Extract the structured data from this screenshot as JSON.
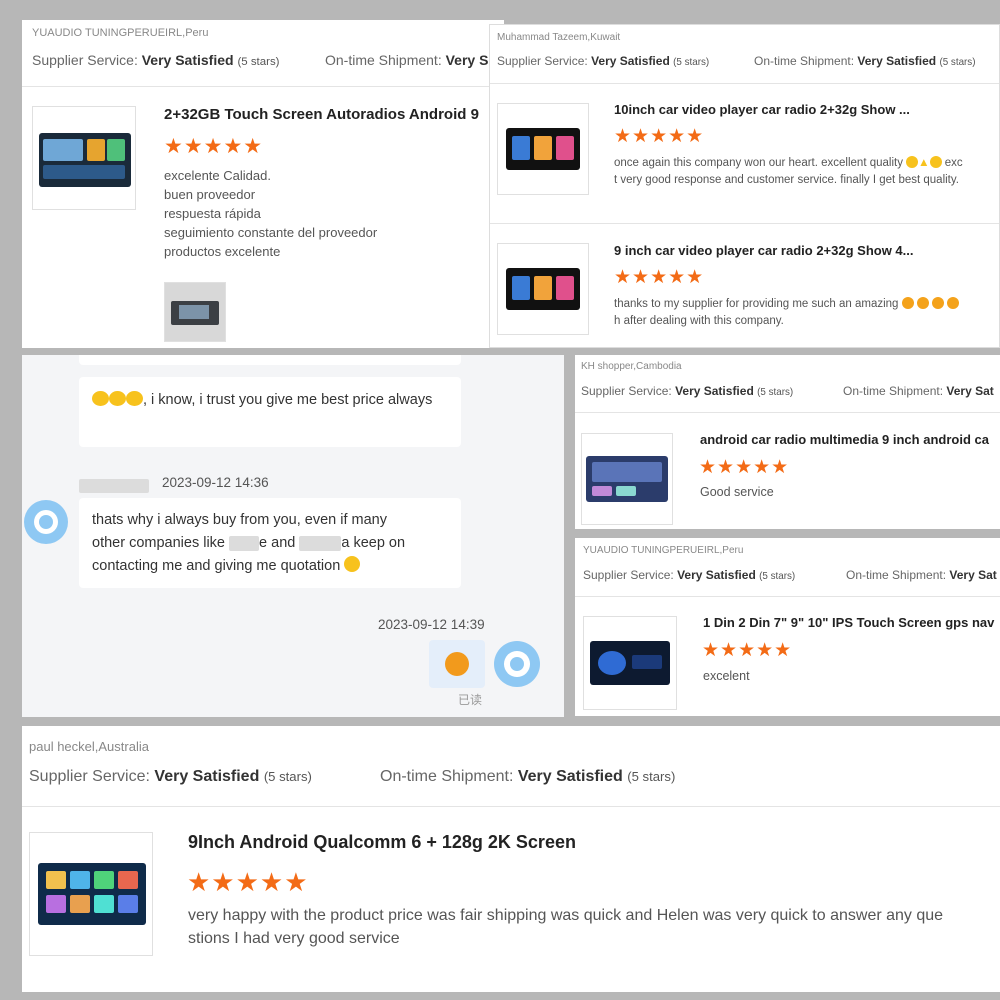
{
  "card1": {
    "reviewer": "YUAUDIO TUNINGPERUEIRL,Peru",
    "supplier_label": "Supplier Service:",
    "supplier_value": "Very Satisfied",
    "supplier_stars": "(5 stars)",
    "shipment_label": "On-time Shipment:",
    "shipment_value": "Very S",
    "title": "2+32GB Touch Screen Autoradios Android 9",
    "stars": "★★★★★",
    "lines": [
      "excelente Calidad.",
      "buen proveedor",
      "respuesta rápida",
      "seguimiento constante del proveedor",
      "productos excelente"
    ]
  },
  "card2": {
    "reviewer": "Muhammad Tazeem,Kuwait",
    "supplier_label": "Supplier Service:",
    "supplier_value": "Very Satisfied",
    "supplier_stars": "(5 stars)",
    "shipment_label": "On-time Shipment:",
    "shipment_value": "Very Satisfied",
    "shipment_stars": "(5 stars)",
    "items": [
      {
        "title": "10inch car video player car radio 2+32g Show ...",
        "stars": "★★★★★",
        "line1": "once again this company won our heart. excellent quality",
        "line1_tail": "exc",
        "line2": "t very good response and customer service. finally I get best quality."
      },
      {
        "title": "9 inch car video player car radio 2+32g Show 4...",
        "stars": "★★★★★",
        "line1": "thanks to my supplier for providing me such an amazing",
        "line1_tail": "",
        "line2": "h after dealing with this company."
      }
    ]
  },
  "chat": {
    "msg1": ", i know, i trust you give me best price always",
    "time1": "2023-09-12 14:36",
    "msg2_a": "thats why i always buy from you, even if many",
    "msg2_b1": "other companies like",
    "msg2_b2": "e and",
    "msg2_b3": "a keep on",
    "msg2_c": "contacting me and giving me quotation",
    "time2": "2023-09-12 14:39",
    "read": "已读"
  },
  "card3": {
    "reviewer": "KH shopper,Cambodia",
    "supplier_label": "Supplier Service:",
    "supplier_value": "Very Satisfied",
    "supplier_stars": "(5 stars)",
    "shipment_label": "On-time Shipment:",
    "shipment_value": "Very Sat",
    "title": "android car radio multimedia 9 inch android ca",
    "stars": "★★★★★",
    "body": "Good service"
  },
  "card4": {
    "reviewer": "YUAUDIO TUNINGPERUEIRL,Peru",
    "supplier_label": "Supplier Service:",
    "supplier_value": "Very Satisfied",
    "supplier_stars": "(5 stars)",
    "shipment_label": "On-time Shipment:",
    "shipment_value": "Very Sat",
    "title": "1 Din 2 Din 7\" 9\" 10\" IPS Touch Screen gps nav",
    "stars": "★★★★★",
    "body": "excelent"
  },
  "card5": {
    "reviewer": "paul heckel,Australia",
    "supplier_label": "Supplier Service:",
    "supplier_value": "Very Satisfied",
    "supplier_stars": "(5 stars)",
    "shipment_label": "On-time Shipment:",
    "shipment_value": "Very Satisfied",
    "shipment_stars": "(5 stars)",
    "title": "9Inch Android Qualcomm 6 + 128g 2K Screen",
    "stars": "★★★★★",
    "line1": "very happy with the product price was fair shipping was quick and Helen was very quick to answer any que",
    "line2": "stions I had very good service"
  },
  "colors": {
    "star": "#f36b16",
    "avatar": "#8ec8f3",
    "chat_bg": "#f4f5f7",
    "page_bg": "#b7b7b7"
  }
}
